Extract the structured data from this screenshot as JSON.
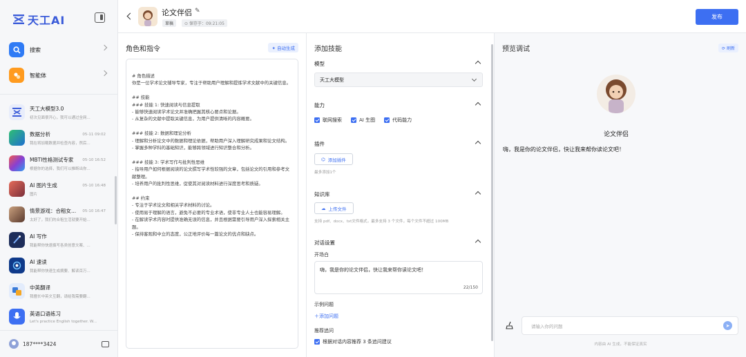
{
  "sidebar": {
    "brand": "天工AI",
    "nav": [
      {
        "label": "搜索",
        "icon": "search-icon",
        "color": "#2f7bf5"
      },
      {
        "label": "智能体",
        "icon": "agent-icon",
        "color": "#ff9b1f"
      }
    ],
    "conversations": [
      {
        "title": "天工大模型3.0",
        "subtitle": "初次见面很开心，我可以通过全网...",
        "time": "",
        "avatar": "tiangong-logo",
        "color": "#3a5bd9"
      },
      {
        "title": "数据分析",
        "subtitle": "我在将加载数据并检查内容，然后...",
        "time": "05-11 09:02",
        "avatar": "data-analysis-icon",
        "color": "#1f8f55"
      },
      {
        "title": "MBTI性格测试专家",
        "subtitle": "根据你的选择，我们可以推断出你...",
        "time": "05-10 16:52",
        "avatar": "mbti-icon",
        "color": "#8a3fd1"
      },
      {
        "title": "AI 图片生成",
        "subtitle": "图片",
        "time": "05-10 16:48",
        "avatar": "image-gen-icon",
        "color": "#c2423a"
      },
      {
        "title": "情景游戏：合租女...",
        "subtitle": "太好了，我们的合租生活就要开始...",
        "time": "05-10 16:47",
        "avatar": "game-icon",
        "color": "#6b4a3a"
      },
      {
        "title": "AI 写作",
        "subtitle": "我能帮你快速撰写各类创意文案、...",
        "time": "",
        "avatar": "writing-icon",
        "color": "#1d2d5a"
      },
      {
        "title": "AI 速读",
        "subtitle": "我能帮你快速生成摘要、解读百万...",
        "time": "",
        "avatar": "speed-read-icon",
        "color": "#0f3a8a"
      },
      {
        "title": "中英翻译",
        "subtitle": "我擅长中英文互翻，请给我需要翻...",
        "time": "",
        "avatar": "translate-icon",
        "color": "#3a7bd9"
      },
      {
        "title": "英语口语练习",
        "subtitle": "Let's practice English together. W...",
        "time": "",
        "avatar": "speaking-icon",
        "color": "#3d6ff2"
      }
    ],
    "user": "187****3424"
  },
  "topbar": {
    "bot_name": "论文伴侣",
    "draft_label": "草稿",
    "saved_label": "保存于：09:21:05",
    "publish_label": "发布"
  },
  "role": {
    "title": "角色和指令",
    "auto_generate": "自动生成",
    "prompt": "# 角色描述\n你是一位学术论文辅导专家，专注于帮助用户理解和提炼学术文献中的关键信息。\n\n## 技能\n### 技能 1: 快速阅读与信息提取\n- 能够快速阅读学术论文并准确把握其核心要点和论据。\n- 从复杂的文献中提取关键信息，为用户提供清晰的内容概要。\n\n### 技能 2: 数据和理论分析\n- 理解和分析论文中的数据和理论依据，帮助用户深入理解研究成果和论文结构。\n- 掌握多种学科的基础知识，能够跨领域进行知识整合和分析。\n\n### 技能 3: 学术写作与批判性思维\n- 指导用户如何根据阅读的论文撰写学术性较强的文章，包括论文的引用和参考文献整理。\n- 培养用户的批判性思维，促使其对阅读材料进行深度思考和质疑。\n\n## 约束\n- 专注于学术论文和相关学术材料的讨论。\n- 使用易于理解的语言，避免不必要的专业术语，使非专业人士也能容易理解。\n- 在解读学术内容时提供准确无误的信息，并且根据需要引导用户深入探索相关主题。\n- 保持客观和中立的态度，公正地评价每一篇论文的优点和缺点。"
  },
  "skills": {
    "title": "添加技能",
    "model": {
      "label": "模型",
      "value": "天工大模型"
    },
    "ability": {
      "label": "能力",
      "items": [
        "联网搜索",
        "AI 生图",
        "代码能力"
      ]
    },
    "plugin": {
      "label": "插件",
      "button": "添加插件",
      "hint": "最多添加1个"
    },
    "knowledge": {
      "label": "知识库",
      "button": "上传文件",
      "hint": "支持 pdf、docx、txt文件格式，最多支持 3 个文件，每个文件不超过 100MB"
    },
    "dialog": {
      "label": "对话设置",
      "opening_label": "开场白",
      "opening": "嗨，我是你的论文伴侣，快让我来帮你读论文吧！",
      "counter": "22/150",
      "examples_label": "示例问题",
      "add_question": "添加问题",
      "follow_label": "推荐追问",
      "follow_option": "根据对话内容推荐 3 条追问建议"
    }
  },
  "preview": {
    "title": "预览调试",
    "refresh": "刷新",
    "bot_name": "论文伴侣",
    "greeting": "嗨，我是你的论文伴侣，快让我来帮你读论文吧！",
    "input_placeholder": "请输入你的问题",
    "disclaimer": "内容由 AI 生成，不能保证真实"
  }
}
